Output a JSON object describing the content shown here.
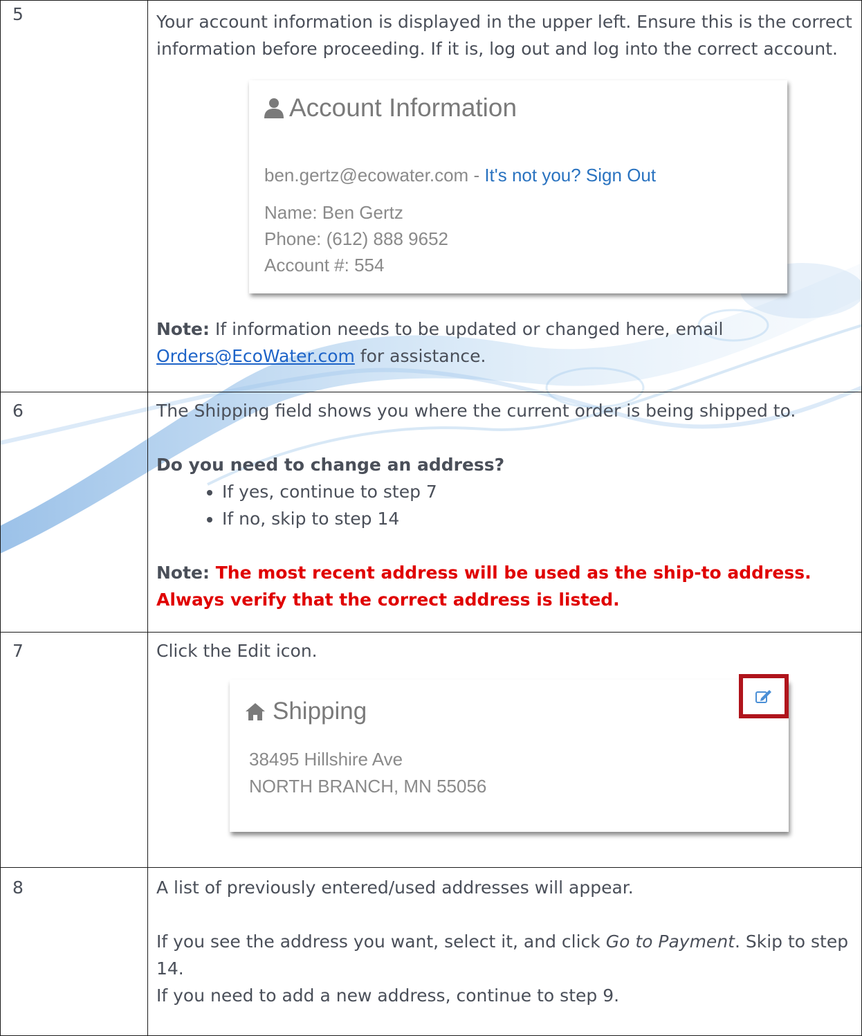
{
  "steps": [
    {
      "num": "5",
      "text": "Your account information is displayed in the upper left. Ensure this is the correct information before proceeding. If it is, log out and log into the correct account.",
      "account_card": {
        "title": "Account Information",
        "email": "ben.gertz@ecowater.com",
        "separator": " - ",
        "sign_out": "It's not you? Sign Out",
        "name": "Name: Ben Gertz",
        "phone": "Phone: (612) 888 9652",
        "account": "Account #: 554",
        "icon": "user-icon"
      },
      "note_label": "Note:",
      "note_text_before": " If information needs to be updated or changed here, email ",
      "note_link": "Orders@EcoWater.com",
      "note_text_after": " for assistance."
    },
    {
      "num": "6",
      "text": "The Shipping field shows you where the current order is being shipped to.",
      "question": "Do you need to change an address?",
      "bullets": [
        "If yes, continue to step 7",
        "If no, skip to step 14"
      ],
      "note_label": "Note: ",
      "note_red": "The most recent address will be used as the ship-to address. Always verify that the correct address is listed."
    },
    {
      "num": "7",
      "text": "Click the Edit icon.",
      "shipping_card": {
        "title": "Shipping",
        "address_line1": "38495 Hillshire Ave",
        "address_line2": "NORTH BRANCH, MN 55056",
        "icon": "home-icon",
        "edit_icon": "edit-icon",
        "highlight_color": "#b0141c"
      }
    },
    {
      "num": "8",
      "text": "A list of previously entered/used addresses will appear.",
      "line2_before": "If you see the address you want, select it, and click ",
      "line2_italic": "Go to Payment",
      "line2_after": ". Skip to step 14.",
      "line3": "If you need to add a new address, continue to step 9."
    }
  ]
}
